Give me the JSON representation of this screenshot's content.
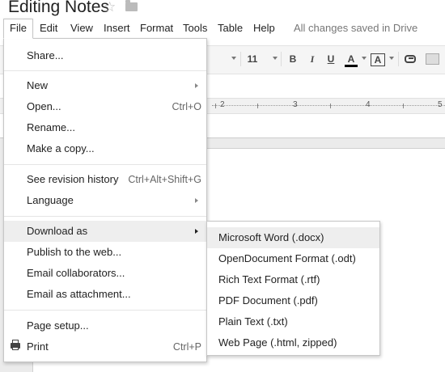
{
  "document": {
    "title": "Editing Notes"
  },
  "menubar": {
    "items": [
      "File",
      "Edit",
      "View",
      "Insert",
      "Format",
      "Tools",
      "Table",
      "Help"
    ],
    "save_status": "All changes saved in Drive"
  },
  "toolbar": {
    "font_size": "11",
    "bold": "B",
    "italic": "I",
    "underline": "U",
    "text_color": "A",
    "highlight_color": "A"
  },
  "ruler": {
    "labels": [
      "2",
      "3",
      "4",
      "5"
    ]
  },
  "file_menu": {
    "share": "Share...",
    "new": "New",
    "open": "Open...",
    "open_shortcut": "Ctrl+O",
    "rename": "Rename...",
    "make_copy": "Make a copy...",
    "revision_history": "See revision history",
    "revision_history_shortcut": "Ctrl+Alt+Shift+G",
    "language": "Language",
    "download_as": "Download as",
    "publish": "Publish to the web...",
    "email_collaborators": "Email collaborators...",
    "email_attachment": "Email as attachment...",
    "page_setup": "Page setup...",
    "print": "Print",
    "print_shortcut": "Ctrl+P"
  },
  "download_submenu": {
    "items": [
      "Microsoft Word (.docx)",
      "OpenDocument Format (.odt)",
      "Rich Text Format (.rtf)",
      "PDF Document (.pdf)",
      "Plain Text (.txt)",
      "Web Page (.html, zipped)"
    ]
  },
  "icons": {
    "star": "star-icon",
    "folder": "folder-icon",
    "link": "link-icon",
    "comment": "comment-icon",
    "print": "print-icon",
    "submenu_arrow": "chevron-right-icon"
  },
  "colors": {
    "menu_highlight": "#eeeeee",
    "toolbar_bg": "#f5f5f5",
    "status_text": "#777777"
  }
}
